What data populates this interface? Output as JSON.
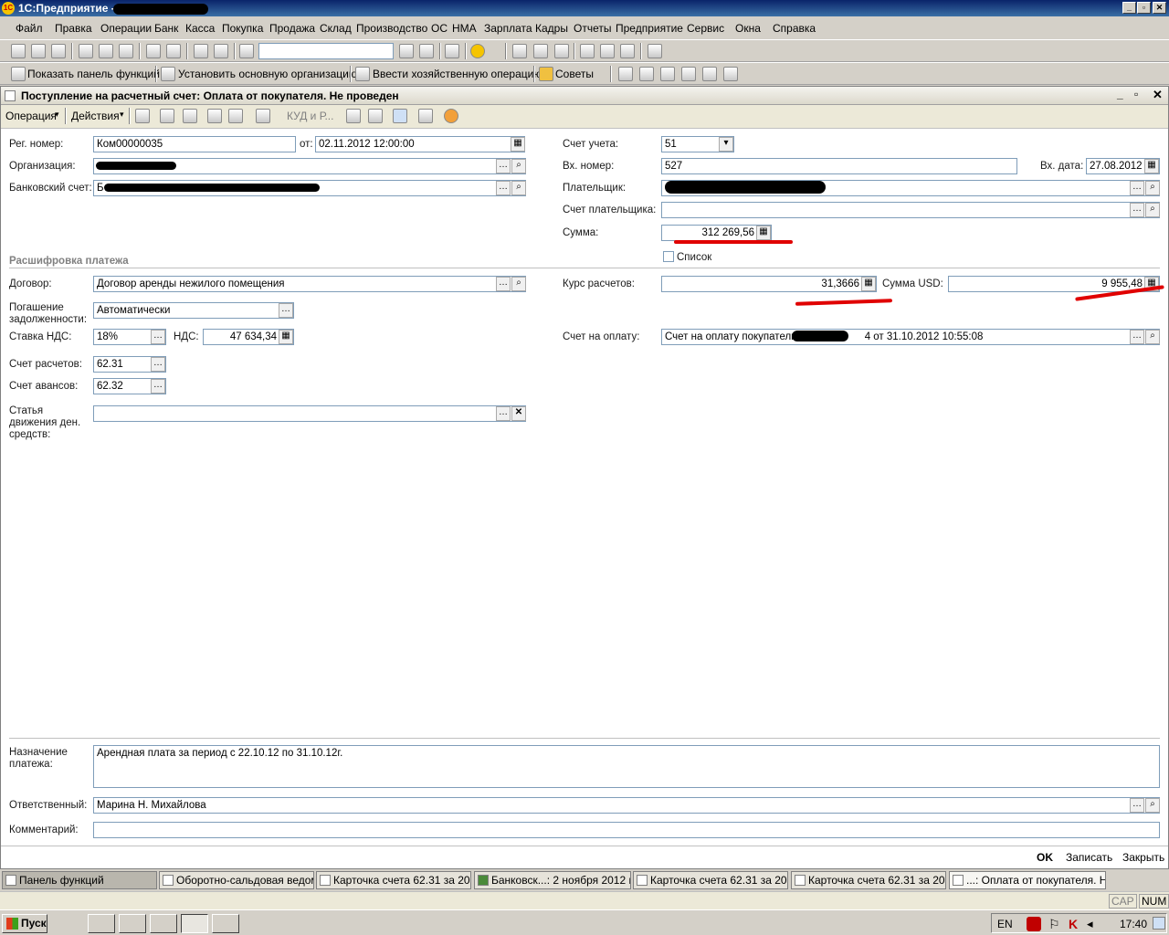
{
  "window": {
    "title": "1С:Предприятие -",
    "minimize": "_",
    "restore": "▫",
    "close": "✕"
  },
  "menu": [
    "Файл",
    "Правка",
    "Операции",
    "Банк",
    "Касса",
    "Покупка",
    "Продажа",
    "Склад",
    "Производство",
    "ОС",
    "НМА",
    "Зарплата",
    "Кадры",
    "Отчеты",
    "Предприятие",
    "Сервис",
    "Окна",
    "Справка"
  ],
  "toolbar2": {
    "show_panel": "Показать панель функций",
    "set_org": "Установить основную организацию",
    "enter_op": "Ввести хозяйственную операцию",
    "tips": "Советы"
  },
  "doc": {
    "title": "Поступление на расчетный счет: Оплата от покупателя. Не проведен",
    "toolbar": {
      "operation": "Операция",
      "actions": "Действия",
      "kud": "КУД и Р..."
    },
    "reg_number_label": "Рег. номер:",
    "reg_number": "Ком00000035",
    "from_label": "от:",
    "date": "02.11.2012 12:00:00",
    "org_label": "Организация:",
    "bank_label": "Банковский счет:",
    "bank_prefix": "Б",
    "account_label": "Счет учета:",
    "account": "51",
    "in_number_label": "Вх. номер:",
    "in_number": "527",
    "in_date_label": "Вх. дата:",
    "in_date": "27.08.2012",
    "payer_label": "Плательщик:",
    "payer_account_label": "Счет плательщика:",
    "sum_label": "Сумма:",
    "sum": "312 269,56",
    "list_label": "Список",
    "section": "Расшифровка платежа",
    "contract_label": "Договор:",
    "contract": "Договор аренды нежилого помещения",
    "rate_label": "Курс расчетов:",
    "rate": "31,3666",
    "sum_usd_label": "Сумма USD:",
    "sum_usd": "9 955,48",
    "debt_label": "Погашение задолженности:",
    "debt": "Автоматически",
    "vat_rate_label": "Ставка НДС:",
    "vat_rate": "18%",
    "vat_label": "НДС:",
    "vat": "47 634,34",
    "invoice_label": "Счет на оплату:",
    "invoice": "Счет на оплату покупателю К",
    "invoice_suffix": "4 от 31.10.2012 10:55:08",
    "settle_label": "Счет расчетов:",
    "settle": "62.31",
    "advance_label": "Счет авансов:",
    "advance": "62.32",
    "cashflow_label": "Статья движения ден. средств:",
    "purpose_label": "Назначение платежа:",
    "purpose": "Арендная плата за период с 22.10.12 по 31.10.12г.",
    "responsible_label": "Ответственный:",
    "responsible": "Марина Н. Михайлова",
    "comment_label": "Комментарий:",
    "ok": "OK",
    "save": "Записать",
    "close": "Закрыть"
  },
  "tasks": [
    "Панель функций",
    "Оборотно-сальдовая ведом...",
    "Карточка счета 62.31 за 20...",
    "Банковск...: 2 ноября 2012 г.",
    "Карточка счета 62.31 за 20...",
    "Карточка счета 62.31 за 20...",
    "...: Оплата от покупателя. Н..."
  ],
  "status": {
    "cap": "CAP",
    "num": "NUM"
  },
  "taskbar": {
    "start": "Пуск",
    "lang": "EN",
    "time": "17:40"
  }
}
